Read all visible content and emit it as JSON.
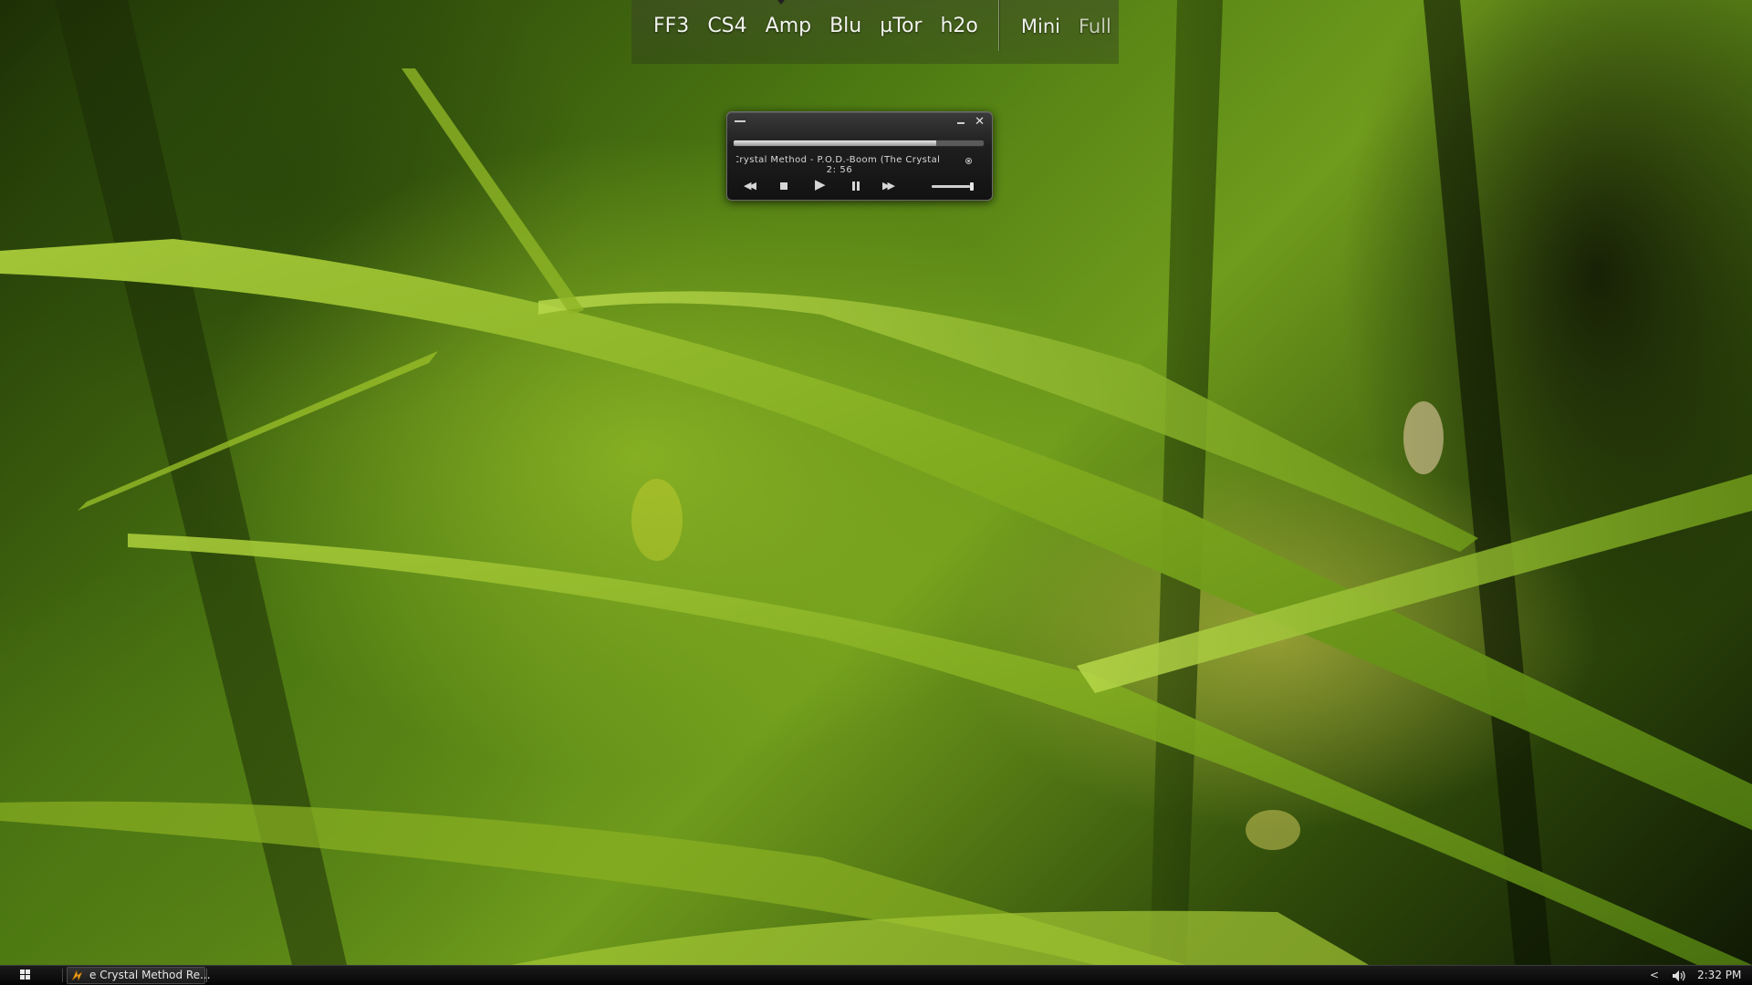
{
  "dock": {
    "apps": [
      "FF3",
      "CS4",
      "Amp",
      "Blu",
      "µTor",
      "h2o"
    ],
    "modes": {
      "mini": "Mini",
      "full": "Full"
    }
  },
  "player": {
    "track_title": "Crystal Method - P.O.D.-Boom (The Crystal",
    "time": "2: 56",
    "seek_progress_percent": 81,
    "volume_percent": 95,
    "icons": {
      "menu": "menu-icon",
      "minimize": "minimize-icon",
      "close": "close-icon",
      "close_glyph": "✕",
      "record": "record-icon",
      "prev": "previous-icon",
      "prev_glyph": "◀◀",
      "stop": "stop-icon",
      "play": "play-icon",
      "play_glyph": "▶",
      "pause": "pause-icon",
      "next": "next-icon",
      "next_glyph": "▶▶"
    }
  },
  "taskbar": {
    "start_icon": "windows-start-icon",
    "task_label": "e Crystal Method Re...",
    "task_icon": "winamp-icon",
    "tray_chevron": "<",
    "tray_volume_icon": "speaker-icon",
    "clock": "2:32 PM"
  },
  "colors": {
    "grass_light": "#9cc22a",
    "grass_dark": "#1d3006",
    "taskbar_bg": "#0d0d0d",
    "player_bg": "#1e1e1e"
  }
}
